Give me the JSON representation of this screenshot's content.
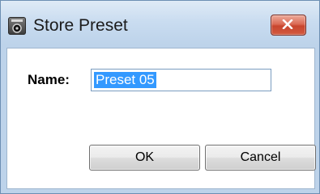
{
  "window": {
    "title": "Store Preset",
    "icon": "app-icon"
  },
  "titlebar": {
    "close_icon": "close-icon",
    "close_color": "#d25a40"
  },
  "form": {
    "name_label": "Name:",
    "name_value": "Preset 05"
  },
  "buttons": {
    "ok_label": "OK",
    "cancel_label": "Cancel"
  },
  "colors": {
    "selection": "#3399ff",
    "titlebar": "#c9dcf0"
  }
}
